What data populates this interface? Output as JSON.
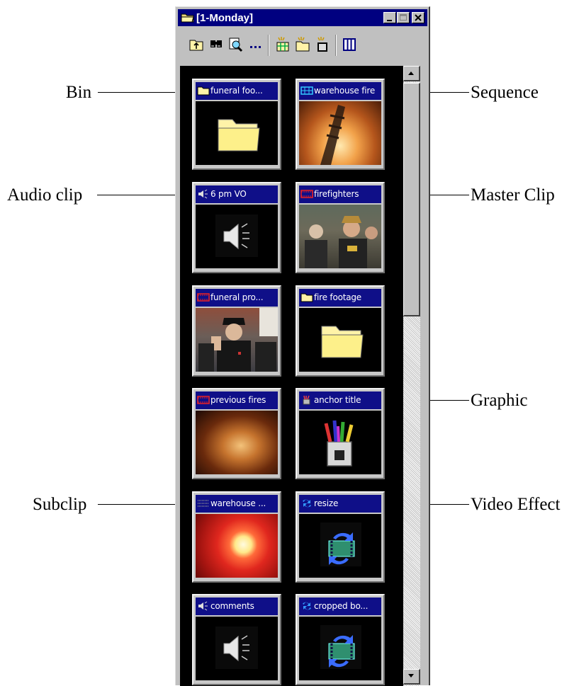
{
  "window": {
    "title": "[1-Monday]",
    "minimize_label": "_",
    "maximize_label": "□",
    "close_label": "×"
  },
  "toolbar": {
    "icons": [
      "bin-up-icon",
      "find-icon",
      "zoom-icon",
      "more-icon",
      "new-sequence-icon",
      "new-bin-icon",
      "new-clip-icon",
      "columns-icon"
    ]
  },
  "callouts": {
    "bin": "Bin",
    "audio_clip": "Audio clip",
    "subclip": "Subclip",
    "sequence": "Sequence",
    "master_clip": "Master Clip",
    "graphic": "Graphic",
    "video_effect": "Video Effect"
  },
  "items": [
    {
      "label": "funeral foo...",
      "type": "bin"
    },
    {
      "label": "warehouse fire",
      "type": "sequence"
    },
    {
      "label": "6 pm VO",
      "type": "audio"
    },
    {
      "label": "firefighters",
      "type": "master-clip"
    },
    {
      "label": "funeral pro...",
      "type": "master-clip"
    },
    {
      "label": "fire footage",
      "type": "bin"
    },
    {
      "label": "previous fires",
      "type": "master-clip"
    },
    {
      "label": "anchor title",
      "type": "graphic"
    },
    {
      "label": "warehouse ...",
      "type": "subclip"
    },
    {
      "label": "resize",
      "type": "effect"
    },
    {
      "label": "comments",
      "type": "audio"
    },
    {
      "label": "cropped bo...",
      "type": "effect"
    }
  ],
  "colors": {
    "title_bar": "#000080",
    "caption_bar": "#0f0f88",
    "bin_background": "#000000",
    "window_chrome": "#c0c0c0"
  }
}
